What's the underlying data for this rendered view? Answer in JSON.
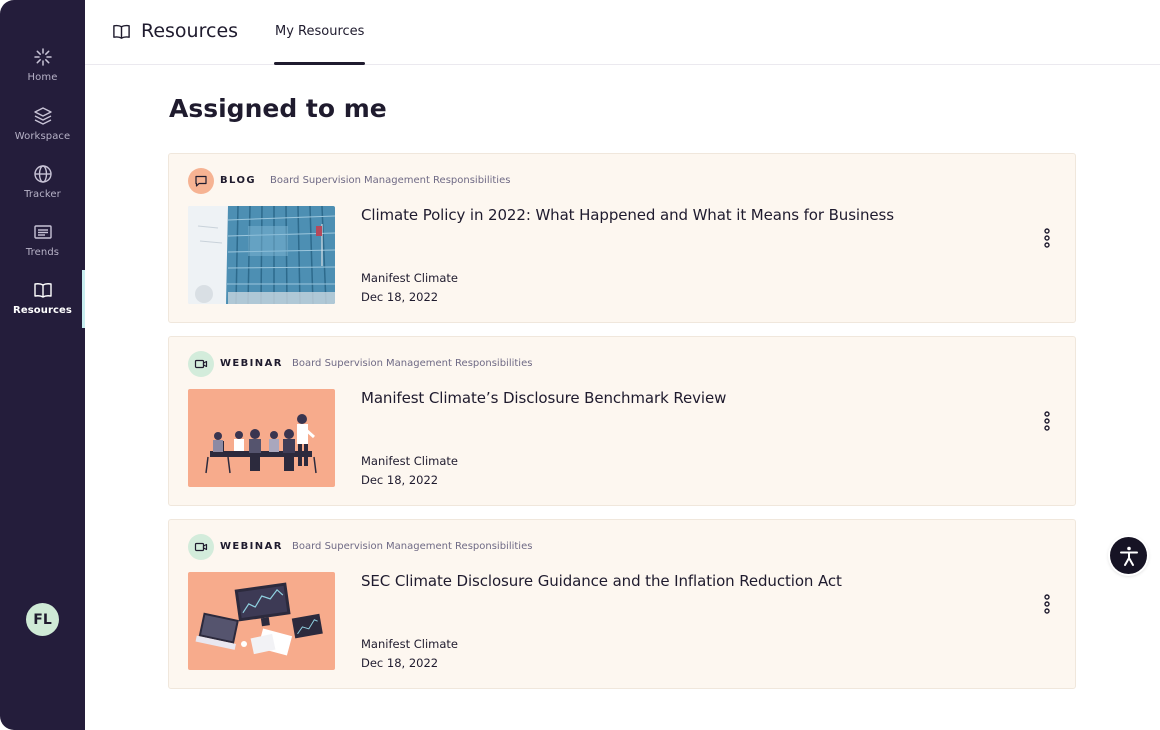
{
  "sidebar": {
    "items": [
      {
        "label": "Home",
        "icon": "home-burst-icon"
      },
      {
        "label": "Workspace",
        "icon": "layers-icon"
      },
      {
        "label": "Tracker",
        "icon": "globe-icon"
      },
      {
        "label": "Trends",
        "icon": "list-icon"
      },
      {
        "label": "Resources",
        "icon": "book-icon",
        "active": true
      }
    ],
    "avatar_initials": "FL"
  },
  "header": {
    "title": "Resources",
    "tabs": [
      {
        "label": "My Resources",
        "active": true
      }
    ]
  },
  "main": {
    "heading": "Assigned to me",
    "cards": [
      {
        "type": "BLOG",
        "type_icon": "chat-bubble-icon",
        "tags": [
          "Board Supervision",
          "Management Responsibilities"
        ],
        "title": "Climate Policy in 2022: What Happened and What it Means for Business",
        "author": "Manifest Climate",
        "date": "Dec 18, 2022",
        "thumbnail": "glass-building-photo"
      },
      {
        "type": "WEBINAR",
        "type_icon": "video-camera-icon",
        "tags": [
          "Board Supervision",
          "Management Responsibilities"
        ],
        "title": "Manifest Climate’s Disclosure Benchmark Review",
        "author": "Manifest Climate",
        "date": "Dec 18, 2022",
        "thumbnail": "meeting-illustration"
      },
      {
        "type": "WEBINAR",
        "type_icon": "video-camera-icon",
        "tags": [
          "Board Supervision",
          "Management Responsibilities"
        ],
        "title": "SEC Climate Disclosure Guidance and the Inflation Reduction Act",
        "author": "Manifest Climate",
        "date": "Dec 18, 2022",
        "thumbnail": "devices-illustration"
      }
    ]
  },
  "colors": {
    "sidebar_bg": "#241d3b",
    "card_bg": "#fdf7f0",
    "blog_badge": "#f6b393",
    "webinar_badge": "#d3ecdb",
    "thumbnail_peach": "#f7ab8c",
    "text_dark": "#1f1b2e"
  }
}
